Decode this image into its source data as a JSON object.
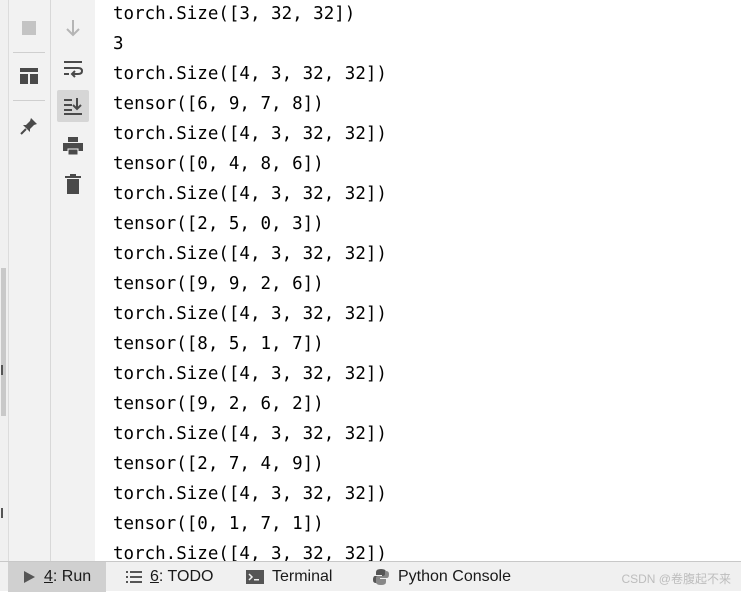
{
  "console": {
    "lines": [
      "torch.Size([3, 32, 32])",
      "3",
      "torch.Size([4, 3, 32, 32])",
      "tensor([6, 9, 7, 8])",
      "torch.Size([4, 3, 32, 32])",
      "tensor([0, 4, 8, 6])",
      "torch.Size([4, 3, 32, 32])",
      "tensor([2, 5, 0, 3])",
      "torch.Size([4, 3, 32, 32])",
      "tensor([9, 9, 2, 6])",
      "torch.Size([4, 3, 32, 32])",
      "tensor([8, 5, 1, 7])",
      "torch.Size([4, 3, 32, 32])",
      "tensor([9, 2, 6, 2])",
      "torch.Size([4, 3, 32, 32])",
      "tensor([2, 7, 4, 9])",
      "torch.Size([4, 3, 32, 32])",
      "tensor([0, 1, 7, 1])",
      "torch.Size([4, 3, 32, 32])"
    ]
  },
  "toolbar_left": {
    "icons": [
      "stop-icon",
      "layout-icon",
      "pin-icon"
    ]
  },
  "toolbar_right": {
    "icons": [
      "scroll-down-arrow-icon",
      "soft-wrap-icon",
      "scroll-to-end-icon",
      "print-icon",
      "trash-icon"
    ]
  },
  "bottom_tabs": {
    "run": {
      "num": "4",
      "label": ": Run"
    },
    "todo": {
      "num": "6",
      "label": ": TODO"
    },
    "terminal": {
      "label": "Terminal"
    },
    "python_console": {
      "label": "Python Console"
    }
  },
  "watermark": "CSDN @卷腹起不来",
  "colors": {
    "active_tab": "#d0d0d0",
    "toolbar": "#f2f2f2",
    "icon": "#4a4a4a",
    "icon_disabled": "#b5b5b5"
  }
}
